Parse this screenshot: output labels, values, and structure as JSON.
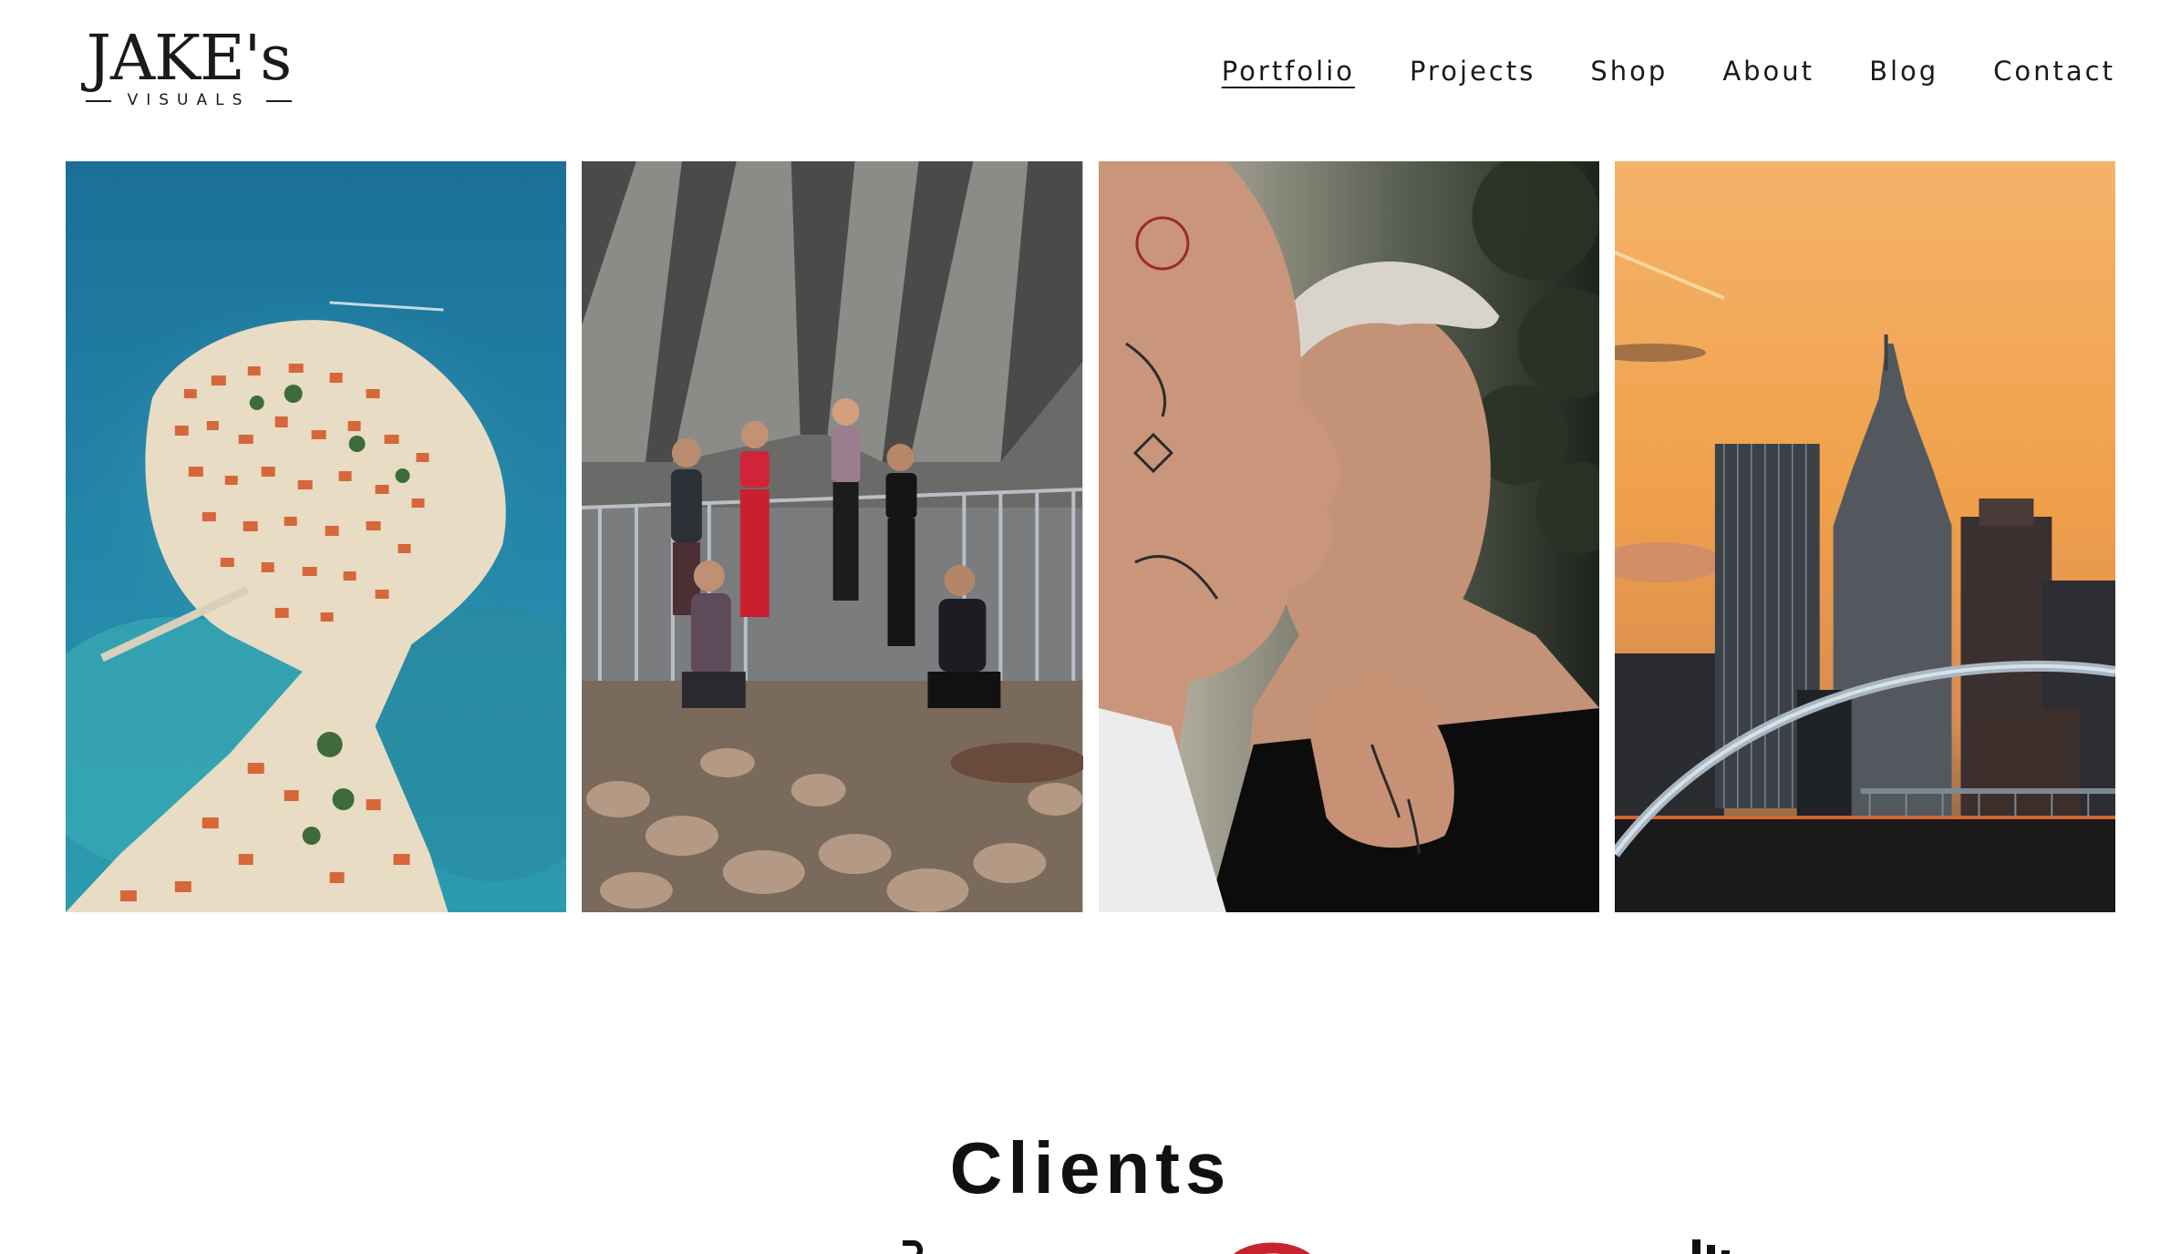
{
  "header": {
    "logo": {
      "wordmark": "JAKE's",
      "subtitle": "VISUALS"
    },
    "nav": [
      {
        "label": "Portfolio",
        "active": true
      },
      {
        "label": "Projects",
        "active": false
      },
      {
        "label": "Shop",
        "active": false
      },
      {
        "label": "About",
        "active": false
      },
      {
        "label": "Blog",
        "active": false
      },
      {
        "label": "Contact",
        "active": false
      }
    ]
  },
  "gallery": {
    "images": [
      {
        "subject": "aerial view of coastal island town",
        "colors": [
          "#1f7aa0",
          "#d8683a",
          "#e9d9bf"
        ]
      },
      {
        "subject": "group of athletes under concrete bridge",
        "colors": [
          "#5a5a5a",
          "#d0243a",
          "#a9917c"
        ]
      },
      {
        "subject": "portrait of two tattooed men",
        "colors": [
          "#0d0d0d",
          "#c9987e",
          "#2b3327"
        ]
      },
      {
        "subject": "city skyline at sunset with bridge arch",
        "colors": [
          "#f0b060",
          "#2e2f36",
          "#8a9fb3"
        ]
      }
    ]
  },
  "clients": {
    "heading": "Clients"
  },
  "theme": {
    "text": "#1a1a1a",
    "background": "#ffffff"
  }
}
